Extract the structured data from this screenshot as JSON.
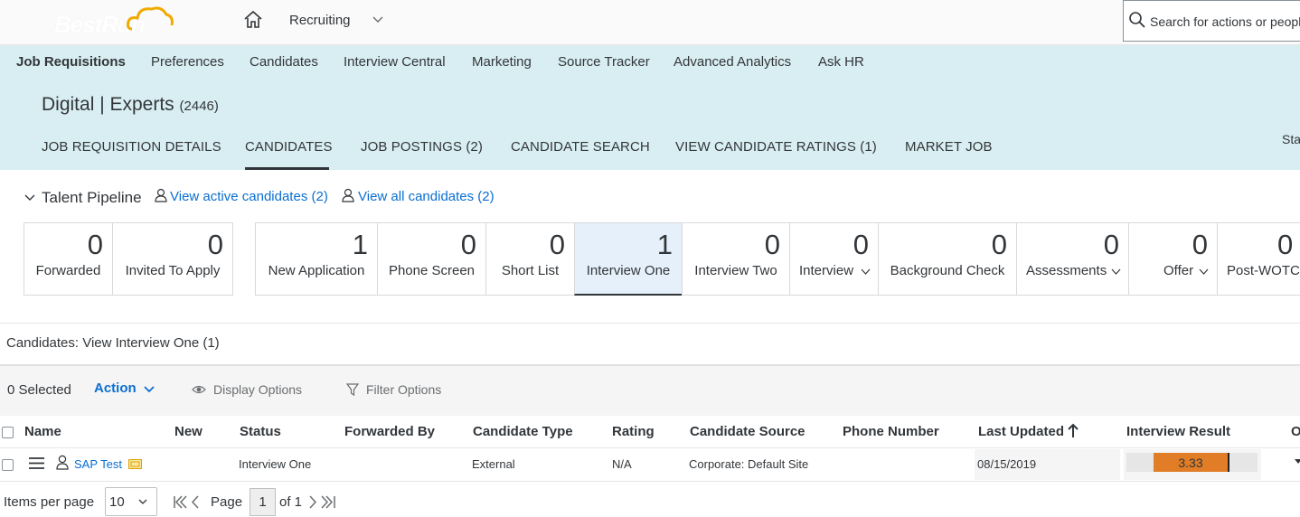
{
  "brand": {
    "logo_text": "BestRun"
  },
  "topbar": {
    "module": "Recruiting",
    "search_placeholder": "Search for actions or people"
  },
  "main_nav": [
    "Job Requisitions",
    "Preferences",
    "Candidates",
    "Interview Central",
    "Marketing",
    "Source Tracker",
    "Advanced Analytics",
    "Ask HR"
  ],
  "requisition": {
    "title": "Digital | Experts",
    "count": "(2446)"
  },
  "sub_tabs": [
    "JOB REQUISITION DETAILS",
    "CANDIDATES",
    "JOB POSTINGS (2)",
    "CANDIDATE SEARCH",
    "VIEW CANDIDATE RATINGS (1)",
    "MARKET JOB"
  ],
  "sub_tabs_overflow": "Sta",
  "pipeline": {
    "title": "Talent Pipeline",
    "active_link": "View active candidates (2)",
    "all_link": "View all candidates (2)",
    "stages": [
      {
        "count": "0",
        "label": "Forwarded"
      },
      {
        "count": "0",
        "label": "Invited To Apply"
      },
      {
        "count": "1",
        "label": "New Application"
      },
      {
        "count": "0",
        "label": "Phone Screen"
      },
      {
        "count": "0",
        "label": "Short List"
      },
      {
        "count": "1",
        "label": "Interview One"
      },
      {
        "count": "0",
        "label": "Interview Two"
      },
      {
        "count": "0",
        "label": "Interview"
      },
      {
        "count": "0",
        "label": "Background Check"
      },
      {
        "count": "0",
        "label": "Assessments"
      },
      {
        "count": "0",
        "label": "Offer"
      },
      {
        "count": "0",
        "label": "Post-WOTC"
      }
    ]
  },
  "candidates_view": "Candidates: View Interview One (1)",
  "toolbar": {
    "selected": "0 Selected",
    "action": "Action",
    "display_options": "Display Options",
    "filter_options": "Filter Options"
  },
  "table": {
    "headers": [
      "Name",
      "New",
      "Status",
      "Forwarded By",
      "Candidate Type",
      "Rating",
      "Candidate Source",
      "Phone Number",
      "Last Updated",
      "Interview Result",
      "O"
    ],
    "rows": [
      {
        "name": "SAP Test",
        "new": "",
        "status": "Interview One",
        "forwarded_by": "",
        "candidate_type": "External",
        "rating": "N/A",
        "candidate_source": "Corporate: Default Site",
        "phone": "",
        "last_updated": "08/15/2019",
        "interview_result": "3.33"
      }
    ]
  },
  "pagination": {
    "items_per_page_label": "Items per page",
    "items_per_page": "10",
    "page_label": "Page",
    "page": "1",
    "of_label": "of 1"
  },
  "colors": {
    "accent": "#0a6ed1",
    "header_bg": "#d9eef2",
    "result_bar": "#e07d26",
    "selected_stage_bg": "#e5f0fa"
  }
}
